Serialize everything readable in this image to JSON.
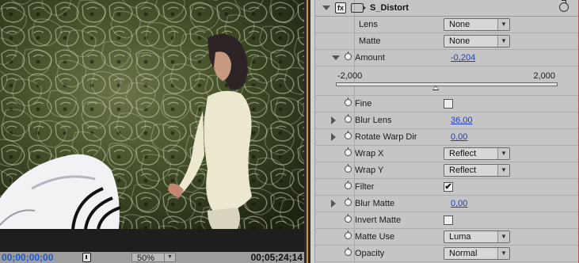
{
  "viewer": {
    "current_time": "00;00;00;00",
    "duration": "00;05;24;14",
    "zoom": "50%"
  },
  "effect": {
    "badge": "fx",
    "name": "S_Distort",
    "params": [
      {
        "label": "Lens",
        "type": "select",
        "value": "None",
        "stopwatch": false,
        "twirl": false
      },
      {
        "label": "Matte",
        "type": "select",
        "value": "None",
        "stopwatch": false,
        "twirl": false
      },
      {
        "label": "Amount",
        "type": "value",
        "value": "-0,204",
        "stopwatch": true,
        "twirl": "open"
      },
      {
        "label": "Fine",
        "type": "checkbox",
        "checked": false,
        "stopwatch": true,
        "twirl": false
      },
      {
        "label": "Blur Lens",
        "type": "value",
        "value": "36,00",
        "stopwatch": true,
        "twirl": "closed"
      },
      {
        "label": "Rotate Warp Dir",
        "type": "value",
        "value": "0,00",
        "stopwatch": true,
        "twirl": "closed"
      },
      {
        "label": "Wrap X",
        "type": "select",
        "value": "Reflect",
        "stopwatch": true,
        "twirl": false
      },
      {
        "label": "Wrap Y",
        "type": "select",
        "value": "Reflect",
        "stopwatch": true,
        "twirl": false
      },
      {
        "label": "Filter",
        "type": "checkbox",
        "checked": true,
        "stopwatch": true,
        "twirl": false
      },
      {
        "label": "Blur Matte",
        "type": "value",
        "value": "0,00",
        "stopwatch": true,
        "twirl": "closed"
      },
      {
        "label": "Invert Matte",
        "type": "checkbox",
        "checked": false,
        "stopwatch": true,
        "twirl": false
      },
      {
        "label": "Matte Use",
        "type": "select",
        "value": "Luma",
        "stopwatch": true,
        "twirl": false
      },
      {
        "label": "Opacity",
        "type": "select",
        "value": "Normal",
        "stopwatch": true,
        "twirl": false
      }
    ],
    "amount_slider": {
      "min": "-2,000",
      "max": "2,000",
      "min_value": -2,
      "max_value": 2,
      "value": -0.204
    }
  },
  "colors": {
    "timecode_current": "#1a5bd6",
    "value_link": "#1c3ccc",
    "panel_accent": "#c99a3a"
  }
}
